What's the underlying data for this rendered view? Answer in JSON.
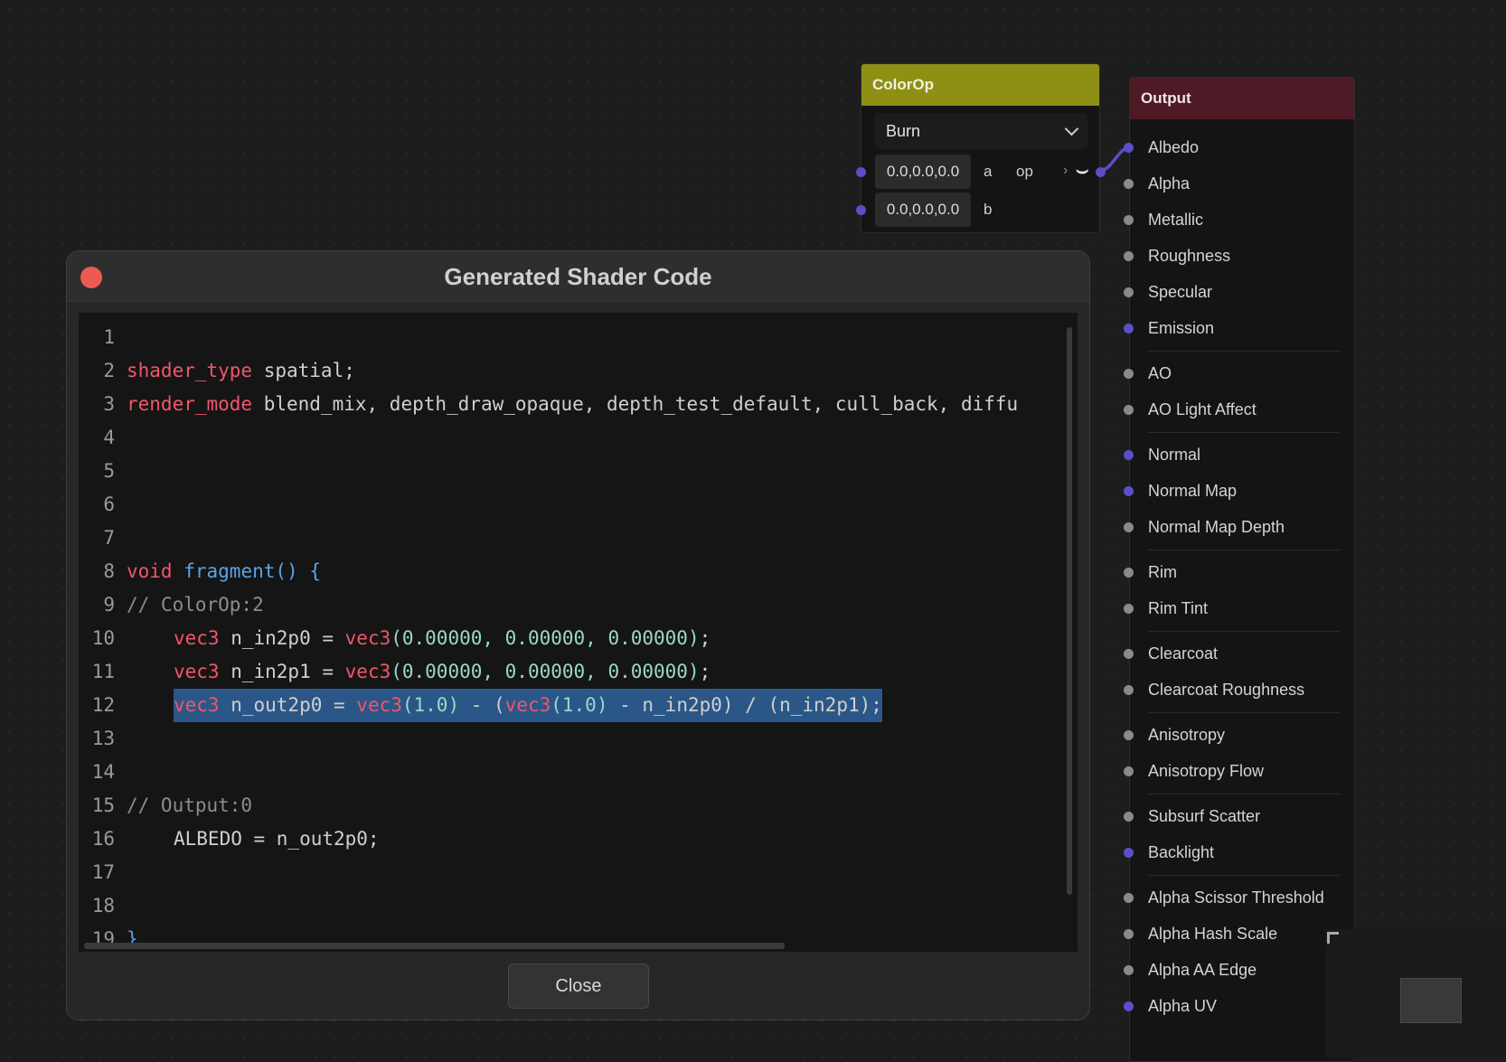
{
  "colorop": {
    "title": "ColorOp",
    "operation": "Burn",
    "inputs": [
      {
        "value": "0.0,0.0,0.0",
        "label": "a"
      },
      {
        "value": "0.0,0.0,0.0",
        "label": "b"
      }
    ],
    "output_label": "op",
    "color": "#8f8f16"
  },
  "output": {
    "title": "Output",
    "color": "#4e1a26",
    "items": [
      "Albedo",
      "Alpha",
      "Metallic",
      "Roughness",
      "Specular",
      "Emission",
      "AO",
      "AO Light Affect",
      "Normal",
      "Normal Map",
      "Normal Map Depth",
      "Rim",
      "Rim Tint",
      "Clearcoat",
      "Clearcoat Roughness",
      "Anisotropy",
      "Anisotropy Flow",
      "Subsurf Scatter",
      "Backlight",
      "Alpha Scissor Threshold",
      "Alpha Hash Scale",
      "Alpha AA Edge",
      "Alpha UV"
    ]
  },
  "dialog": {
    "title": "Generated Shader Code",
    "close_label": "Close",
    "line_numbers": [
      "1",
      "2",
      "3",
      "4",
      "5",
      "6",
      "7",
      "8",
      "9",
      "10",
      "11",
      "12",
      "13",
      "14",
      "15",
      "16",
      "17",
      "18",
      "19"
    ],
    "code": {
      "l1_kw": "shader_type",
      "l1_rest": " spatial;",
      "l2_kw": "render_mode",
      "l2_rest": " blend_mix, depth_draw_opaque, depth_test_default, cull_back, diffu",
      "l7_void": "void",
      "l7_fn": "fragment",
      "l7_rest": "() {",
      "l8": "// ColorOp:2",
      "l9_type": "vec3",
      "l9_var": " n_in2p0 = ",
      "l9_ctor": "vec3",
      "l9_args": "(0.00000, 0.00000, 0.00000)",
      "l9_end": ";",
      "l10_type": "vec3",
      "l10_var": " n_in2p1 = ",
      "l10_ctor": "vec3",
      "l10_args": "(0.00000, 0.00000, 0.00000)",
      "l10_end": ";",
      "l11_type": "vec3",
      "l11_a": " n_out2p0 = ",
      "l11_c1": "vec3",
      "l11_n1": "(1.0)",
      "l11_b": " - (",
      "l11_c2": "vec3",
      "l11_n2": "(1.0)",
      "l11_rest": " - n_in2p0) / (n_in2p1);",
      "l14": "// Output:0",
      "l15": "ALBEDO = n_out2p0;",
      "l18": "}"
    }
  },
  "colors": {
    "keyword": "#f0566a",
    "function": "#5aa3e8",
    "number": "#9ad9c8",
    "comment": "#8d8d8d",
    "selection": "#2a5788",
    "port_purple": "#5a4fc8",
    "port_grey": "#8a8a8a",
    "close_dot": "#ed5a52"
  }
}
